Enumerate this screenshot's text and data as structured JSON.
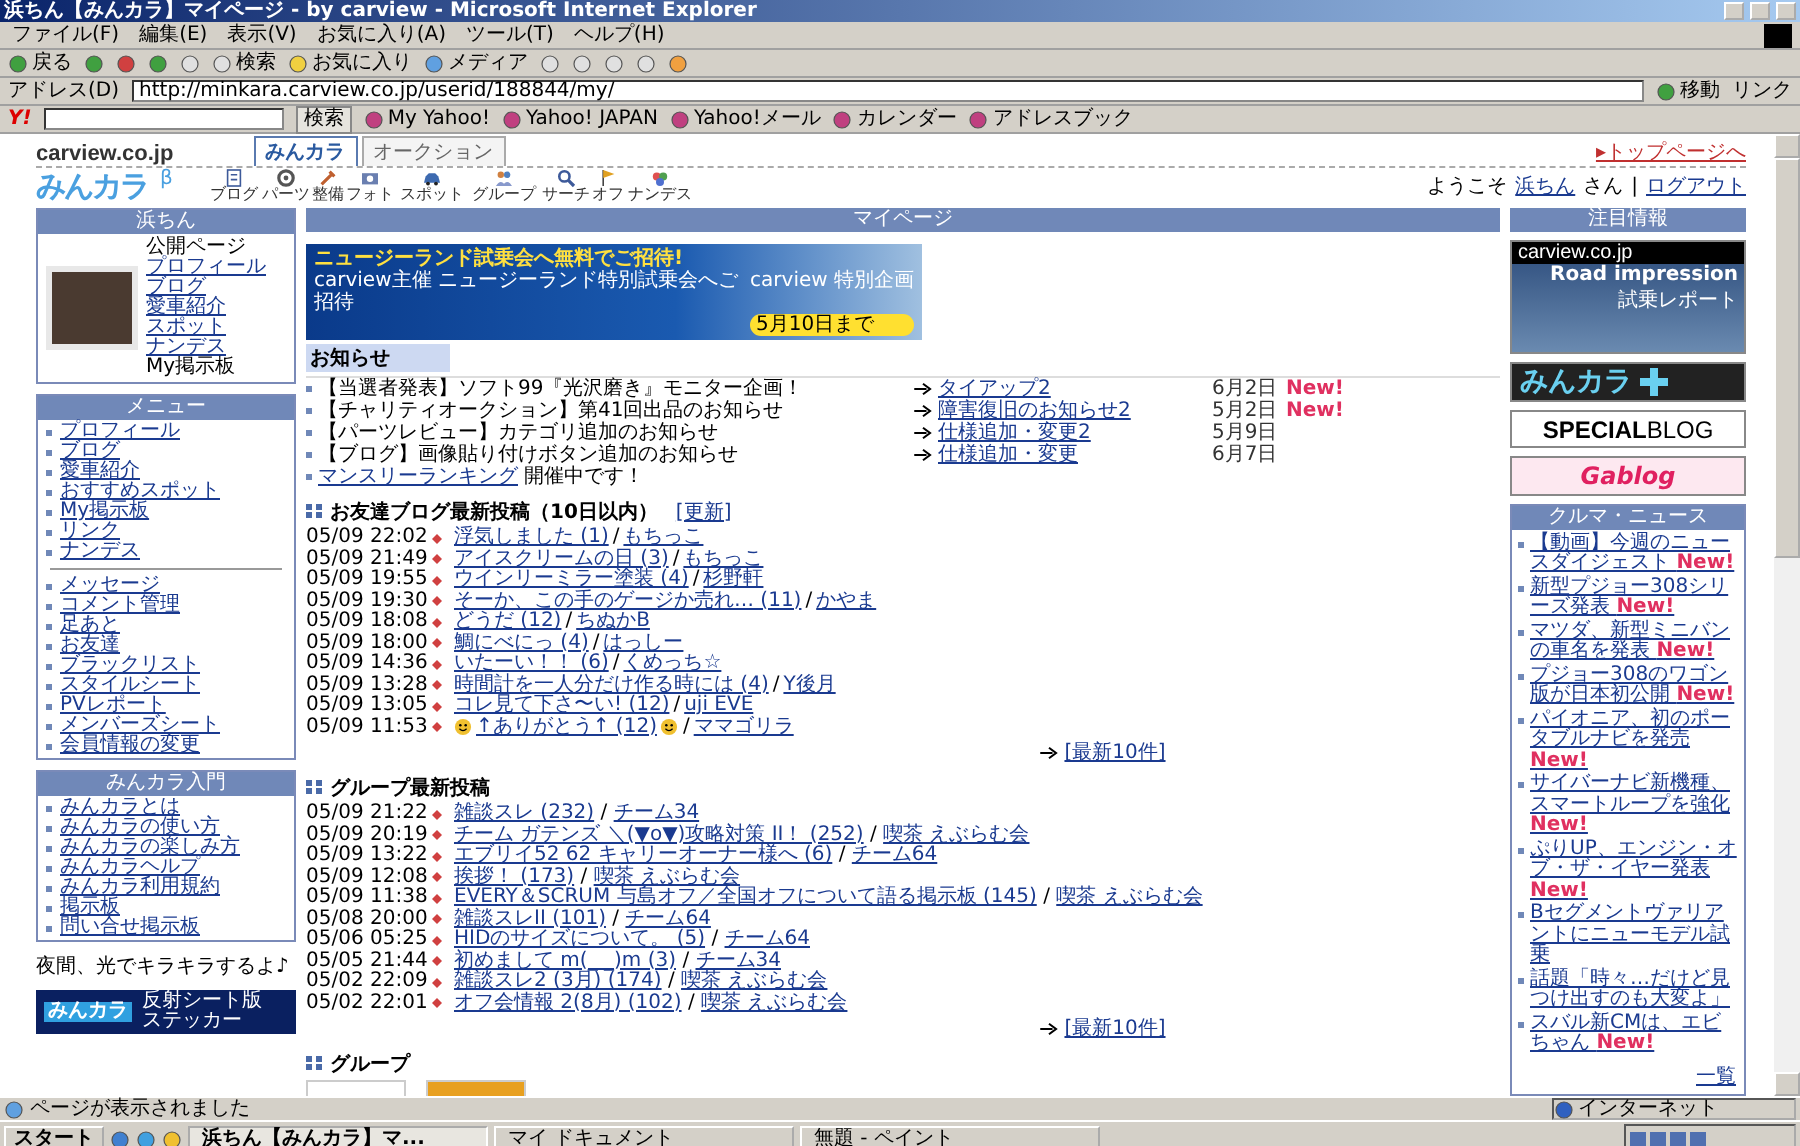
{
  "window": {
    "title": "浜ちん【みんカラ】マイページ - by carview - Microsoft Internet Explorer"
  },
  "menu_bar": [
    "ファイル(F)",
    "編集(E)",
    "表示(V)",
    "お気に入り(A)",
    "ツール(T)",
    "ヘルプ(H)"
  ],
  "toolbar": {
    "back": "戻る",
    "search": "検索",
    "favorites": "お気に入り",
    "media": "メディア"
  },
  "address_bar": {
    "label": "アドレス(D)",
    "value": "http://minkara.carview.co.jp/userid/188844/my/",
    "go": "移動",
    "links": "リンク"
  },
  "yahoo_toolbar": {
    "logo": "Y!",
    "search_button": "検索",
    "items": [
      "My Yahoo!",
      "Yahoo! JAPAN",
      "Yahoo!メール",
      "カレンダー",
      "アドレスブック"
    ]
  },
  "site_header": {
    "logo": "carview.co.jp",
    "tabs": [
      {
        "label": "みんカラ",
        "selected": true
      },
      {
        "label": "オークション",
        "selected": false
      }
    ],
    "top_link": "▸トップページへ",
    "brand": "みんカラ",
    "brand_mark": "β",
    "nav": [
      "ブログ",
      "パーツ",
      "整備",
      "フォト",
      "スポット",
      "グループ",
      "サーチ",
      "オフ",
      "ナンデス"
    ],
    "welcome": "ようこそ",
    "user": "浜ちん",
    "honorific": "さん",
    "divider": "|",
    "logout": "ログアウト"
  },
  "left": {
    "profile": {
      "title": "浜ちん",
      "links": [
        {
          "label": "公開ページ",
          "link": false
        },
        {
          "label": "プロフィール",
          "link": true
        },
        {
          "label": "ブログ",
          "link": true
        },
        {
          "label": "愛車紹介",
          "link": true
        },
        {
          "label": "スポット",
          "link": true
        },
        {
          "label": "ナンデス",
          "link": true
        },
        {
          "label": "My掲示板",
          "link": false
        }
      ]
    },
    "menu": {
      "title": "メニュー",
      "groups": [
        [
          "プロフィール",
          "ブログ",
          "愛車紹介",
          "おすすめスポット",
          "My掲示板",
          "リンク",
          "ナンデス"
        ],
        [
          "メッセージ",
          "コメント管理",
          "足あと",
          "お友達",
          "ブラックリスト",
          "スタイルシート",
          "PVレポート",
          "メンバーズシート",
          "会員情報の変更"
        ]
      ]
    },
    "guide": {
      "title": "みんカラ入門",
      "items": [
        "みんカラとは",
        "みんカラの使い方",
        "みんカラの楽しみ方",
        "みんカラヘルプ",
        "みんカラ利用規約",
        "掲示板",
        "問い合せ掲示板"
      ]
    },
    "promo": {
      "caption": "夜間、光でキラキラするよ♪",
      "brand": "みんカラ",
      "lines": [
        "反射シート版",
        "ステッカー"
      ]
    }
  },
  "center": {
    "title": "マイページ",
    "banner": {
      "headline": "ニュージーランド試乗会へ無料でご招待!",
      "line": "carview主催 ニュージーランド特別試乗会へご招待",
      "deadline": "5月10日まで",
      "sponsor": "carview 特別企画"
    },
    "notices": {
      "title": "お知らせ",
      "items": [
        {
          "text": "【当選者発表】ソフト99『光沢磨き』モニター企画！"
        },
        {
          "text": "【チャリティオークション】第41回出品のお知らせ"
        },
        {
          "text": "【パーツレビュー】カテゴリ追加のお知らせ"
        },
        {
          "text": "【ブログ】画像貼り付けボタン追加のお知らせ"
        },
        {
          "link": "マンスリーランキング",
          "text": "開催中です！"
        }
      ],
      "updates": [
        {
          "label": "タイアップ2",
          "date": "6月2日",
          "badge": "New!"
        },
        {
          "label": "障害復旧のお知らせ2",
          "date": "5月2日",
          "badge": "New!"
        },
        {
          "label": "仕様追加・変更2",
          "date": "5月9日"
        },
        {
          "label": "仕様追加・変更",
          "date": "6月7日"
        }
      ]
    },
    "separator": "/",
    "friends": {
      "title": "お友達ブログ最新投稿（10日以内）",
      "refresh": "[更新]",
      "more": "[最新10件]",
      "posts": [
        {
          "time": "05/09 22:02",
          "title": "浮気しました (1)",
          "author": "もちっこ",
          "smiley": false
        },
        {
          "time": "05/09 21:49",
          "title": "アイスクリームの日 (3)",
          "author": "もちっこ",
          "smiley": false
        },
        {
          "time": "05/09 19:55",
          "title": "ウインリーミラー塗装 (4)",
          "author": "杉野軒",
          "smiley": false
        },
        {
          "time": "05/09 19:30",
          "title": "そーか、この手のゲージか売れ… (11)",
          "author": "かやま",
          "smiley": false
        },
        {
          "time": "05/09 18:08",
          "title": "どうだ (12)",
          "author": "ちぬかB",
          "smiley": false
        },
        {
          "time": "05/09 18:00",
          "title": "鯛にべにっ (4)",
          "author": "はっしー",
          "smiley": false
        },
        {
          "time": "05/09 14:36",
          "title": "いたーい！！ (6)",
          "author": "くめっち☆",
          "smiley": false
        },
        {
          "time": "05/09 13:28",
          "title": "時間計を一人分だけ作る時には (4)",
          "author": "Y後月",
          "smiley": false
        },
        {
          "time": "05/09 13:05",
          "title": "コレ見て下さ〜い! (12)",
          "author": "uji EVE",
          "smiley": false
        },
        {
          "time": "05/09 11:53",
          "title": "↑ありがとう↑ (12)",
          "author": "ママゴリラ",
          "smiley": true
        }
      ]
    },
    "groups": {
      "title": "グループ最新投稿",
      "more": "[最新10件]",
      "posts": [
        {
          "time": "05/09 21:22",
          "title": "雑談スレ (232)",
          "author": "チーム34"
        },
        {
          "time": "05/09 20:19",
          "title": "チーム ガテンズ ＼(▼o▼)攻略対策 II！ (252)",
          "author": "喫茶 えぶらむ会"
        },
        {
          "time": "05/09 13:22",
          "title": "エブリイ52 62 キャリーオーナー様へ (6)",
          "author": "チーム64"
        },
        {
          "time": "05/09 12:08",
          "title": "挨拶！ (173)",
          "author": "喫茶 えぶらむ会"
        },
        {
          "time": "05/09 11:38",
          "title": "EVERY＆SCRUM 与島オフ／全国オフについて語る掲示板 (145)",
          "author": "喫茶 えぶらむ会"
        },
        {
          "time": "05/08 20:00",
          "title": "雑談スレII (101)",
          "author": "チーム64"
        },
        {
          "time": "05/06 05:25",
          "title": "HIDのサイズについて。 (5)",
          "author": "チーム64"
        },
        {
          "time": "05/05 21:44",
          "title": "初めまして m(_ _)m (3)",
          "author": "チーム34"
        },
        {
          "time": "05/02 22:09",
          "title": "雑談スレ2 (3月) (174)",
          "author": "喫茶 えぶらむ会"
        },
        {
          "time": "05/02 22:01",
          "title": "オフ会情報 2(8月) (102)",
          "author": "喫茶 えぶらむ会"
        }
      ]
    },
    "group_list": {
      "title": "グループ"
    }
  },
  "right": {
    "title": "注目情報",
    "road": {
      "brand": "carview.co.jp",
      "heading": "Road impression",
      "sub": "試乗レポート"
    },
    "plus": {
      "text": "みんカラ"
    },
    "special": {
      "bold": "SPECIAL",
      "light": "BLOG"
    },
    "gablog": {
      "text": "Gablog"
    },
    "news": {
      "title": "クルマ・ニュース",
      "more": "一覧",
      "items": [
        {
          "text": "【動画】今週のニュースダイジェスト",
          "badge": "New!"
        },
        {
          "text": "新型プジョー308シリーズ発表",
          "badge": "New!"
        },
        {
          "text": "マツダ、新型ミニバンの車名を発表",
          "badge": "New!"
        },
        {
          "text": "プジョー308のワゴン版が日本初公開",
          "badge": "New!"
        },
        {
          "text": "パイオニア、初のポータブルナビを発売",
          "badge": "New!"
        },
        {
          "text": "サイバーナビ新機種、スマートループを強化",
          "badge": "New!"
        },
        {
          "text": "ぷりUP、エンジン・オブ・ザ・イヤー発表",
          "badge": "New!"
        },
        {
          "text": "Bセグメントヴァリアントにニューモデル試乗"
        },
        {
          "text": "話題「時々…だけど見つけ出すのも大変よ」"
        },
        {
          "text": "スバル新CMは、エビちゃん",
          "badge": "New!"
        }
      ]
    }
  },
  "status_bar": {
    "text": "ページが表示されました",
    "zone": "インターネット"
  },
  "taskbar": {
    "start": "スタート",
    "tasks": [
      {
        "label": "浜ちん【みんカラ】マ...",
        "selected": true
      },
      {
        "label": "マイ ドキュメント",
        "selected": false
      },
      {
        "label": "無題 - ペイント",
        "selected": false
      }
    ]
  }
}
